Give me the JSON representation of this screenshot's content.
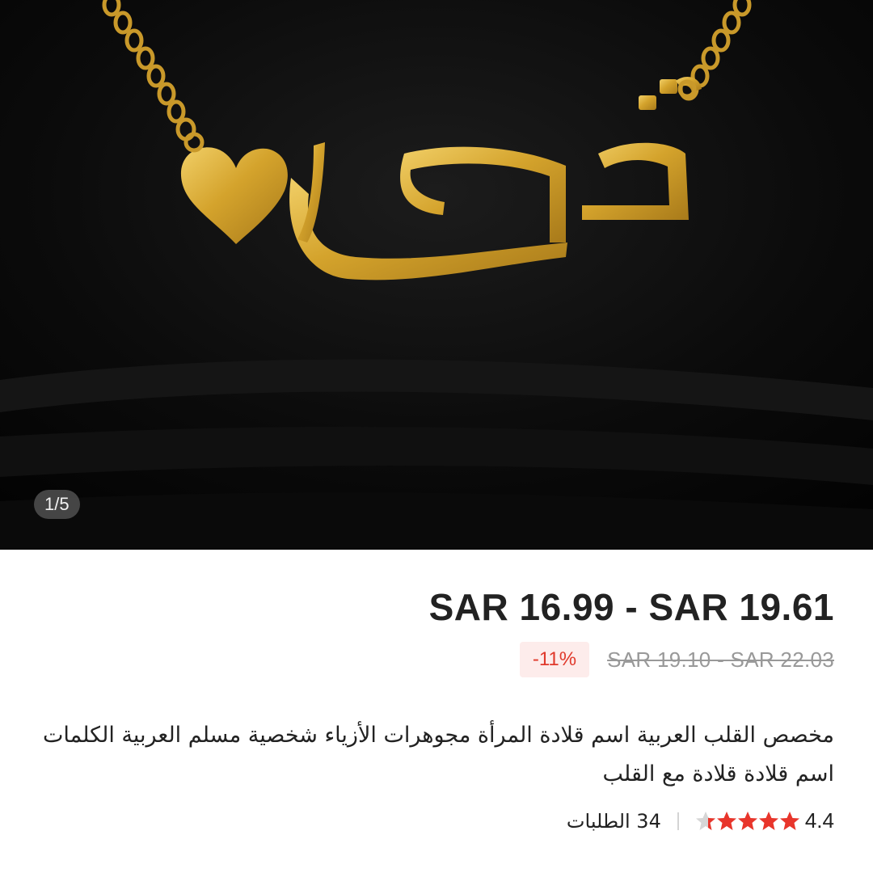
{
  "gallery": {
    "image_alt": "Gold Arabic name necklace with heart on black fabric",
    "counter": "1/5"
  },
  "product": {
    "price_range": "SAR 16.99 - SAR 19.61",
    "discount_badge": "-11%",
    "original_price_range": "SAR 19.10 - SAR 22.03",
    "title": "مخصص القلب العربية اسم قلادة المرأة مجوهرات الأزياء شخصية مسلم العربية الكلمات اسم قلادة قلادة مع القلب",
    "rating": "4.4",
    "rating_stars_filled": 4.4,
    "rating_stars_total": 5,
    "orders": "34 الطلبات"
  },
  "colors": {
    "price": "#222222",
    "discount_text": "#e0392b",
    "discount_bg": "#fdeceb",
    "star_filled": "#e8352b",
    "star_empty": "#d6d6d6",
    "necklace_gold": "#d4a32c"
  }
}
